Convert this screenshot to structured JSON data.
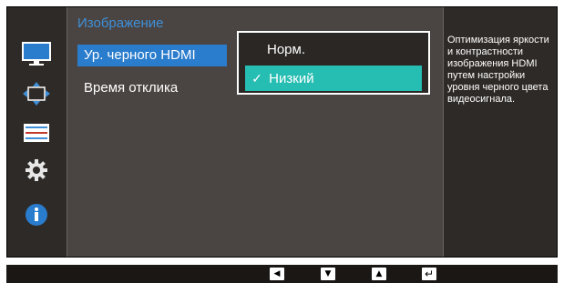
{
  "menu": {
    "section_title": "Изображение",
    "items": [
      {
        "label": "Ур. черного HDMI",
        "selected": true
      },
      {
        "label": "Время отклика",
        "selected": false
      }
    ]
  },
  "submenu": {
    "options": [
      {
        "label": "Норм.",
        "selected": false
      },
      {
        "label": "Низкий",
        "selected": true
      }
    ],
    "check_glyph": "✓"
  },
  "help": {
    "text": "Оптимизация яркости и контрастности изображения HDMI путем настройки уровня черного цвета видеосигнала."
  },
  "side_icons": [
    "monitor-icon",
    "position-arrows-icon",
    "settings-bar-icon",
    "gear-icon",
    "info-icon"
  ],
  "nav_keys": [
    {
      "name": "left-key-icon",
      "glyph": "◀"
    },
    {
      "name": "down-key-icon",
      "glyph": "▼"
    },
    {
      "name": "up-key-icon",
      "glyph": "▲"
    },
    {
      "name": "enter-key-icon",
      "glyph": "↵"
    }
  ],
  "colors": {
    "accent_blue": "#2a7ccd",
    "title_blue": "#3f8fd9",
    "selected_teal": "#26bdb2",
    "panel_bg": "#4a4542",
    "frame_bg": "#2e2a27"
  }
}
